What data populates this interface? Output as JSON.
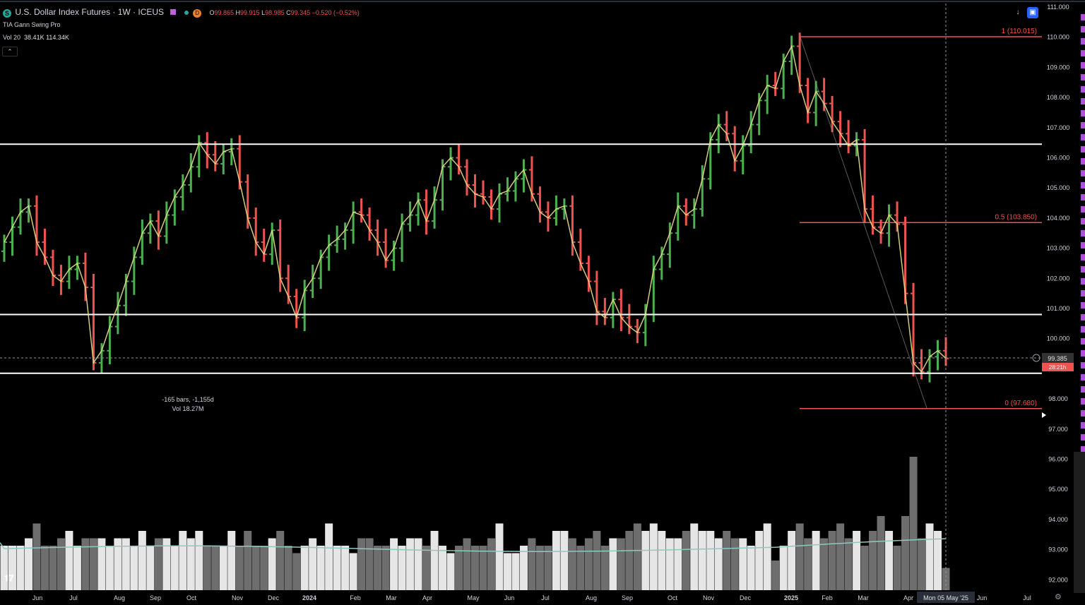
{
  "header": {
    "symbol_icon": "S",
    "title": "U.S. Dollar Index Futures · 1W · ICEUS",
    "d_badge": "D",
    "ohlc": {
      "o": "99.865",
      "h": "99.915",
      "l": "98.985",
      "c": "99.345",
      "chg": "−0.520 (−0.52%)"
    },
    "indicator": "TIA Gann Swing Pro",
    "vol_label": "Vol 20",
    "vol_values": "38.41K  114.34K",
    "collapse_icon": "chevron-up-icon"
  },
  "toolbar": {
    "download_icon": "download-icon",
    "snapshot_icon": "snapshot-icon"
  },
  "measure": {
    "line1": "-165 bars, -1,155d",
    "line2": "Vol 18.27M"
  },
  "colors": {
    "up": "#4caf50",
    "down": "#ef5350",
    "swing": "#e8e08a",
    "level": "#ffffff",
    "fib": "#ef5350",
    "volume_up": "#e6e6e6",
    "volume_down": "#6e6e6e",
    "vol_ma": "#8ec9c0",
    "background": "#000000"
  },
  "chart_data": {
    "type": "ohlc-bar",
    "title": "U.S. Dollar Index Futures · 1W · ICEUS",
    "y_axis_labels": [
      "111.000",
      "110.000",
      "109.000",
      "108.000",
      "107.000",
      "106.000",
      "105.000",
      "104.000",
      "103.000",
      "102.000",
      "101.000",
      "100.000",
      "99.000",
      "98.000",
      "97.000",
      "96.000",
      "95.000",
      "94.000",
      "93.000",
      "92.000"
    ],
    "ylim": [
      91.65,
      111.3
    ],
    "x_axis_labels": [
      "Jun",
      "Jul",
      "Aug",
      "Sep",
      "Oct",
      "Nov",
      "Dec",
      "2024",
      "Feb",
      "Mar",
      "Apr",
      "May",
      "Jun",
      "Jul",
      "Aug",
      "Sep",
      "Oct",
      "Nov",
      "Dec",
      "2025",
      "Feb",
      "Mar",
      "Apr",
      "Jun",
      "Jul"
    ],
    "crosshair_date": "Mon 05 May '25",
    "current_price": "99.385",
    "countdown": "28:21h",
    "horizontal_levels": [
      106.45,
      100.8,
      98.85
    ],
    "fib_levels": [
      {
        "label": "1 (110.015)",
        "value": 110.015
      },
      {
        "label": "0.5 (103.850)",
        "value": 103.85
      },
      {
        "label": "0 (97.680)",
        "value": 97.68
      }
    ],
    "close_series": [
      103.2,
      103.7,
      104.2,
      104.4,
      103.2,
      102.7,
      102.1,
      101.9,
      102.3,
      102.5,
      101.7,
      99.2,
      99.6,
      100.4,
      101.1,
      101.9,
      102.7,
      103.5,
      103.9,
      103.4,
      104.1,
      104.7,
      105.1,
      105.7,
      106.5,
      106.1,
      105.8,
      106.2,
      106.3,
      105.2,
      104.0,
      103.2,
      102.8,
      103.6,
      102.0,
      101.4,
      100.7,
      101.6,
      102.0,
      102.7,
      103.1,
      103.3,
      103.6,
      104.2,
      104.1,
      103.6,
      103.2,
      102.6,
      103.0,
      103.8,
      104.1,
      104.6,
      103.9,
      104.6,
      105.7,
      106.0,
      105.7,
      105.1,
      104.8,
      104.7,
      104.3,
      104.8,
      104.9,
      105.3,
      105.6,
      104.8,
      104.2,
      104.0,
      104.3,
      104.4,
      103.2,
      102.5,
      101.9,
      100.9,
      100.7,
      101.3,
      100.7,
      100.4,
      100.2,
      100.8,
      102.3,
      102.8,
      103.5,
      104.4,
      104.1,
      104.3,
      105.3,
      106.6,
      107.1,
      106.8,
      105.9,
      106.4,
      107.1,
      107.9,
      108.4,
      108.3,
      109.2,
      109.7,
      108.4,
      107.5,
      108.2,
      107.8,
      107.2,
      106.8,
      106.4,
      106.6,
      104.3,
      103.7,
      103.5,
      104.1,
      103.8,
      101.5,
      99.2,
      98.9,
      99.4,
      99.6,
      99.345
    ],
    "volume_relative": [
      0.3,
      0.3,
      0.3,
      0.35,
      0.45,
      0.3,
      0.3,
      0.35,
      0.4,
      0.3,
      0.35,
      0.35,
      0.35,
      0.3,
      0.35,
      0.35,
      0.3,
      0.4,
      0.3,
      0.35,
      0.35,
      0.3,
      0.4,
      0.35,
      0.4,
      0.3,
      0.3,
      0.3,
      0.4,
      0.3,
      0.4,
      0.3,
      0.3,
      0.35,
      0.4,
      0.3,
      0.25,
      0.3,
      0.35,
      0.3,
      0.45,
      0.3,
      0.3,
      0.25,
      0.35,
      0.35,
      0.3,
      0.3,
      0.35,
      0.3,
      0.35,
      0.35,
      0.3,
      0.4,
      0.3,
      0.25,
      0.3,
      0.35,
      0.3,
      0.3,
      0.35,
      0.45,
      0.25,
      0.25,
      0.3,
      0.35,
      0.3,
      0.3,
      0.4,
      0.4,
      0.35,
      0.3,
      0.35,
      0.4,
      0.3,
      0.35,
      0.35,
      0.4,
      0.45,
      0.4,
      0.45,
      0.4,
      0.35,
      0.35,
      0.4,
      0.45,
      0.4,
      0.4,
      0.35,
      0.4,
      0.35,
      0.35,
      0.3,
      0.4,
      0.45,
      0.2,
      0.3,
      0.4,
      0.45,
      0.35,
      0.4,
      0.35,
      0.4,
      0.45,
      0.35,
      0.4,
      0.3,
      0.4,
      0.5,
      0.4,
      0.3,
      0.5,
      0.9,
      0.35,
      0.45,
      0.4,
      0.15
    ]
  }
}
